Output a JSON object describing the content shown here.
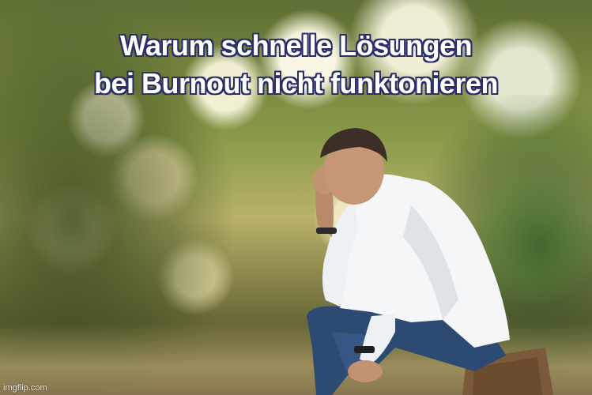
{
  "meme": {
    "caption_line1": "Warum schnelle Lösungen",
    "caption_line2": "bei Burnout nicht funktonieren",
    "watermark": "imgflip.com"
  },
  "colors": {
    "caption_fill": "#ffffff",
    "caption_outline": "#2a2f6a",
    "shirt": "#f4f6f8",
    "jeans": "#2d4a72"
  }
}
